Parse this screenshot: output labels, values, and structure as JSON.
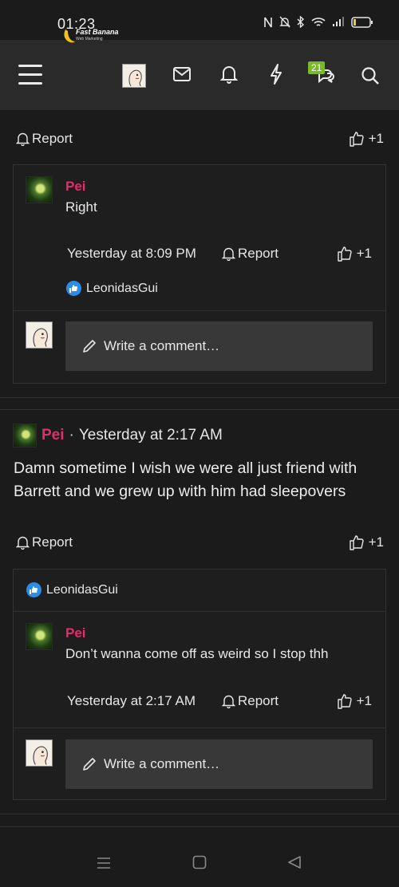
{
  "status_bar": {
    "time": "01:23"
  },
  "nav": {
    "logo_text": "Fast Banana",
    "logo_sub": "Web Marketing",
    "messages_badge": "21"
  },
  "comment1": {
    "report_label": "Report",
    "like_label": "+1",
    "reply": {
      "author": "Pei",
      "text": "Right",
      "timestamp": "Yesterday at 8:09 PM",
      "report_label": "Report",
      "like_label": "+1",
      "reactor": "LeonidasGui"
    },
    "write_placeholder": "Write a comment…"
  },
  "post2": {
    "author": "Pei",
    "separator": "·",
    "timestamp": "Yesterday at 2:17 AM",
    "body": "Damn sometime I wish we were all just friend with Barrett and we grew up with him had sleepovers",
    "report_label": "Report",
    "like_label": "+1",
    "reactor": "LeonidasGui",
    "reply": {
      "author": "Pei",
      "text": "Don’t wanna come off as weird so I stop thh",
      "timestamp": "Yesterday at 2:17 AM",
      "report_label": "Report",
      "like_label": "+1"
    },
    "write_placeholder": "Write a comment…"
  },
  "colors": {
    "author": "#e0306b",
    "badge": "#7ab929",
    "reaction": "#2c8de8"
  }
}
